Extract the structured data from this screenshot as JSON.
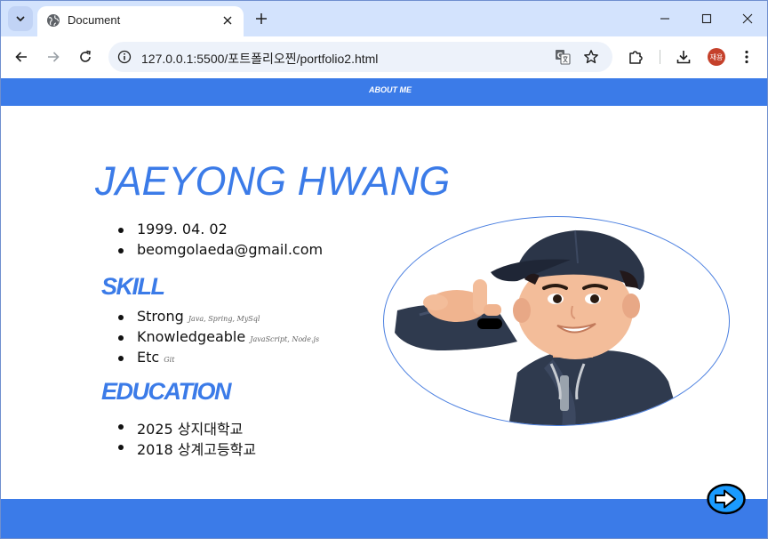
{
  "browser": {
    "tab": {
      "title": "Document"
    },
    "address": {
      "url": "127.0.0.1:5500/포트폴리오찐/portfolio2.html"
    },
    "profile": {
      "initials": "재용",
      "color": "#c5412b"
    }
  },
  "page": {
    "nav": {
      "label": "ABOUT ME"
    },
    "name": "JAEYONG HWANG",
    "info": [
      "1999. 04. 02",
      "beomgolaeda@gmail.com"
    ],
    "skill": {
      "title": "SKILL",
      "items": [
        {
          "label": "Strong",
          "detail": "Java, Spring, MySql"
        },
        {
          "label": "Knowledgeable",
          "detail": "JavaScript, Node.js"
        },
        {
          "label": "Etc",
          "detail": "Git"
        }
      ]
    },
    "education": {
      "title": "EDUCATION",
      "items": [
        "2025 상지대학교",
        "2018 상계고등학교"
      ]
    },
    "colors": {
      "accent": "#3b7be8"
    },
    "icons": {
      "next": "arrow-right-circle-icon",
      "photo": "memoji-avatar"
    }
  }
}
